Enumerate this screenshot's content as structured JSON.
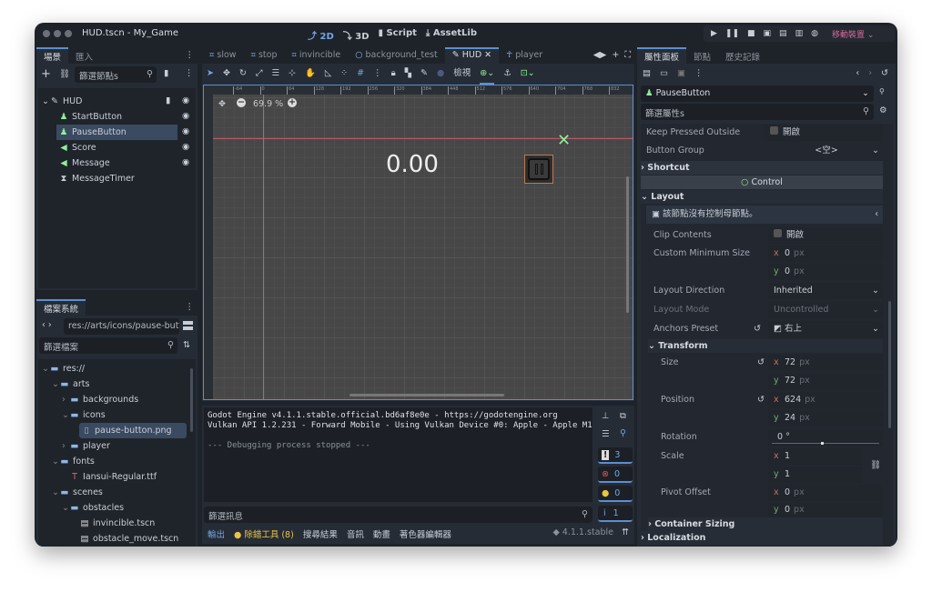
{
  "window": {
    "title": "HUD.tscn - My_Game"
  },
  "workspaces": [
    {
      "icon": "2d-icon",
      "label": "2D",
      "active": true
    },
    {
      "icon": "3d-icon",
      "label": "3D"
    },
    {
      "icon": "script-icon",
      "label": "Script"
    },
    {
      "icon": "assetlib-icon",
      "label": "AssetLib"
    }
  ],
  "run": {
    "icons": [
      "play-icon",
      "pause-icon",
      "stop-icon",
      "remote-debug-icon",
      "play-scene-icon",
      "play-custom-icon",
      "movie-icon"
    ],
    "device": "移動裝置"
  },
  "scene_dock": {
    "tabs": [
      "場景",
      "匯入"
    ],
    "filter_placeholder": "篩選節點s",
    "nodes": [
      {
        "name": "HUD",
        "icon": "control-icon",
        "level": 0,
        "script": true,
        "visible": true
      },
      {
        "name": "StartButton",
        "icon": "button-icon",
        "level": 1,
        "visible": true
      },
      {
        "name": "PauseButton",
        "icon": "button-icon",
        "level": 1,
        "visible": true,
        "selected": true
      },
      {
        "name": "Score",
        "icon": "label-icon",
        "level": 1,
        "visible": true
      },
      {
        "name": "Message",
        "icon": "label-icon",
        "level": 1,
        "visible": true
      },
      {
        "name": "MessageTimer",
        "icon": "timer-icon",
        "level": 1
      }
    ]
  },
  "fs_dock": {
    "tab": "檔案系統",
    "path": "res://arts/icons/pause-butt",
    "filter_placeholder": "篩選檔案",
    "items": [
      {
        "name": "res://",
        "type": "folder",
        "level": 0,
        "open": true
      },
      {
        "name": "arts",
        "type": "folder",
        "level": 1,
        "open": true
      },
      {
        "name": "backgrounds",
        "type": "folder",
        "level": 2
      },
      {
        "name": "icons",
        "type": "folder",
        "level": 2,
        "open": true
      },
      {
        "name": "pause-button.png",
        "type": "image",
        "level": 3,
        "selected": true
      },
      {
        "name": "player",
        "type": "folder",
        "level": 2
      },
      {
        "name": "fonts",
        "type": "folder",
        "level": 1,
        "open": true
      },
      {
        "name": "Iansui-Regular.ttf",
        "type": "font",
        "level": 2
      },
      {
        "name": "scenes",
        "type": "folder",
        "level": 1,
        "open": true
      },
      {
        "name": "obstacles",
        "type": "folder",
        "level": 2,
        "open": true
      },
      {
        "name": "invincible.tscn",
        "type": "scene",
        "level": 3
      },
      {
        "name": "obstacle_move.tscn",
        "type": "scene",
        "level": 3
      }
    ]
  },
  "scene_tabs": [
    {
      "label": "slow",
      "icon": "scene-icon"
    },
    {
      "label": "stop",
      "icon": "scene-icon"
    },
    {
      "label": "invincible",
      "icon": "scene-icon"
    },
    {
      "label": "background_test",
      "icon": "node-icon"
    },
    {
      "label": "HUD",
      "icon": "control-icon",
      "active": true
    },
    {
      "label": "player",
      "icon": "character-icon"
    }
  ],
  "toolbar": {
    "view_label": "檢視"
  },
  "viewport": {
    "zoom": "69.9 %",
    "ruler_ticks": [
      "-64",
      "0",
      "64",
      "128",
      "192",
      "256",
      "320",
      "384",
      "448",
      "512",
      "576",
      "640",
      "704",
      "768",
      "832"
    ],
    "score_text": "0.00"
  },
  "output": {
    "lines": [
      "Godot Engine v4.1.1.stable.official.bd6af8e0e - https://godotengine.org",
      "Vulkan API 1.2.231 - Forward Mobile - Using Vulkan Device #0: Apple - Apple M1",
      "",
      "--- Debugging process stopped ---"
    ],
    "filter_placeholder": "篩選訊息",
    "counts": {
      "messages": "3",
      "errors": "0",
      "warnings": "0",
      "info": "1"
    }
  },
  "bottom_tabs": [
    {
      "label": "輸出",
      "active": true
    },
    {
      "label": "除錯工具 (8)",
      "warn": true
    },
    {
      "label": "搜尋結果"
    },
    {
      "label": "音訊"
    },
    {
      "label": "動畫"
    },
    {
      "label": "著色器編輯器"
    }
  ],
  "version": "4.1.1.stable",
  "inspector": {
    "tabs": [
      "屬性面板",
      "節點",
      "歷史記錄"
    ],
    "node": "PauseButton",
    "filter_placeholder": "篩選屬性s",
    "keep_pressed_label": "Keep Pressed Outside",
    "keep_pressed_value": "開啟",
    "button_group_label": "Button Group",
    "button_group_value": "<空>",
    "shortcut": "Shortcut",
    "control": "Control",
    "layout": "Layout",
    "layout_note": "該節點沒有控制母節點。",
    "clip_label": "Clip Contents",
    "clip_value": "開啟",
    "min_size_label": "Custom Minimum Size",
    "min_x": "0",
    "min_y": "0",
    "dir_label": "Layout Direction",
    "dir_value": "Inherited",
    "mode_label": "Layout Mode",
    "mode_value": "Uncontrolled",
    "anchors_label": "Anchors Preset",
    "anchors_value": "右上",
    "transform": "Transform",
    "size_label": "Size",
    "size_x": "72",
    "size_y": "72",
    "pos_label": "Position",
    "pos_x": "624",
    "pos_y": "24",
    "rot_label": "Rotation",
    "rot_value": "0 °",
    "scale_label": "Scale",
    "scale_x": "1",
    "scale_y": "1",
    "pivot_label": "Pivot Offset",
    "pivot_x": "0",
    "pivot_y": "0",
    "container_sizing": "Container Sizing",
    "localization": "Localization",
    "unit": "px"
  },
  "colors": {
    "accent": "#5b8fd1",
    "selection": "#3a4a60",
    "warning": "#e8c444",
    "error": "#e05555",
    "node_green": "#8eef97"
  }
}
